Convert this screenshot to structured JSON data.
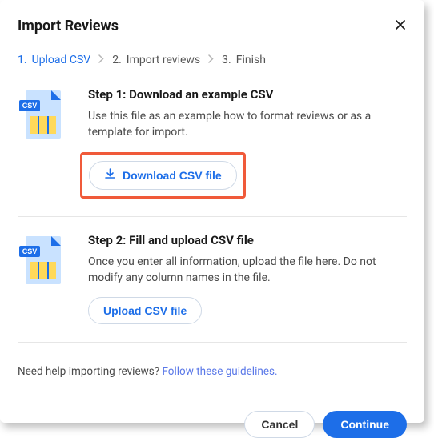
{
  "header": {
    "title": "Import Reviews"
  },
  "stepper": {
    "steps": [
      {
        "num": "1.",
        "label": "Upload CSV",
        "active": true
      },
      {
        "num": "2.",
        "label": "Import reviews",
        "active": false
      },
      {
        "num": "3.",
        "label": "Finish",
        "active": false
      }
    ]
  },
  "section1": {
    "title": "Step 1: Download an example CSV",
    "desc": "Use this file as an example how to format reviews or as a template for import.",
    "button": "Download CSV file"
  },
  "section2": {
    "title": "Step 2: Fill and upload CSV file",
    "desc": "Once you enter all information, upload the file here. Do not modify any column names in the file.",
    "button": "Upload CSV file"
  },
  "help": {
    "text": "Need help importing reviews? ",
    "link": "Follow these guidelines."
  },
  "footer": {
    "cancel": "Cancel",
    "continue": "Continue"
  },
  "icons": {
    "csv_badge": "CSV"
  }
}
